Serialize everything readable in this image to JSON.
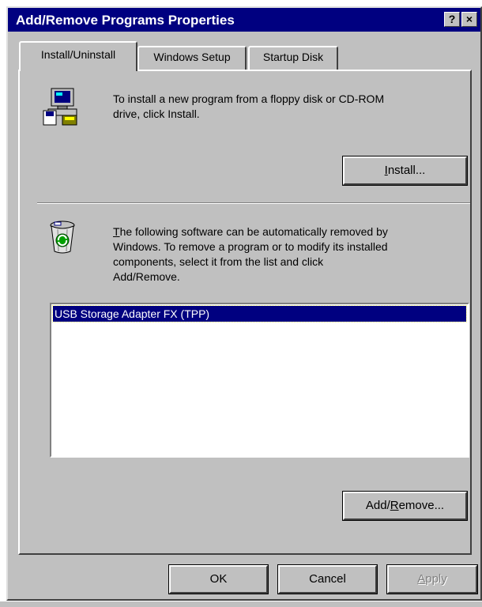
{
  "window": {
    "title": "Add/Remove Programs Properties",
    "help_button": "?",
    "close_button": "×"
  },
  "tabs": [
    {
      "label": "Install/Uninstall",
      "active": true
    },
    {
      "label": "Windows Setup",
      "active": false
    },
    {
      "label": "Startup Disk",
      "active": false
    }
  ],
  "install_section": {
    "icon": "install-program-icon",
    "line1": "To install a new program from a floppy disk or CD-ROM",
    "line2": "drive, click Install.",
    "button_pre": "",
    "button_mnemonic": "I",
    "button_post": "nstall..."
  },
  "remove_section": {
    "icon": "recycle-bin-icon",
    "line1_mnemonic": "T",
    "line1_rest": "he following software can be automatically removed by",
    "line2": "Windows. To remove a program or to modify its installed",
    "line3": "components, select it from the list and click",
    "line4": "Add/Remove.",
    "list_items": [
      "USB Storage Adapter FX (TPP)"
    ],
    "selected_index": 0,
    "button_pre": "Add/",
    "button_mnemonic": "R",
    "button_post": "emove..."
  },
  "footer": {
    "ok_label": "OK",
    "cancel_label": "Cancel",
    "apply_pre": "",
    "apply_mnemonic": "A",
    "apply_post": "pply",
    "apply_enabled": false
  },
  "colors": {
    "title_bar": "#000080",
    "face": "#c0c0c0",
    "selection": "#000080"
  }
}
